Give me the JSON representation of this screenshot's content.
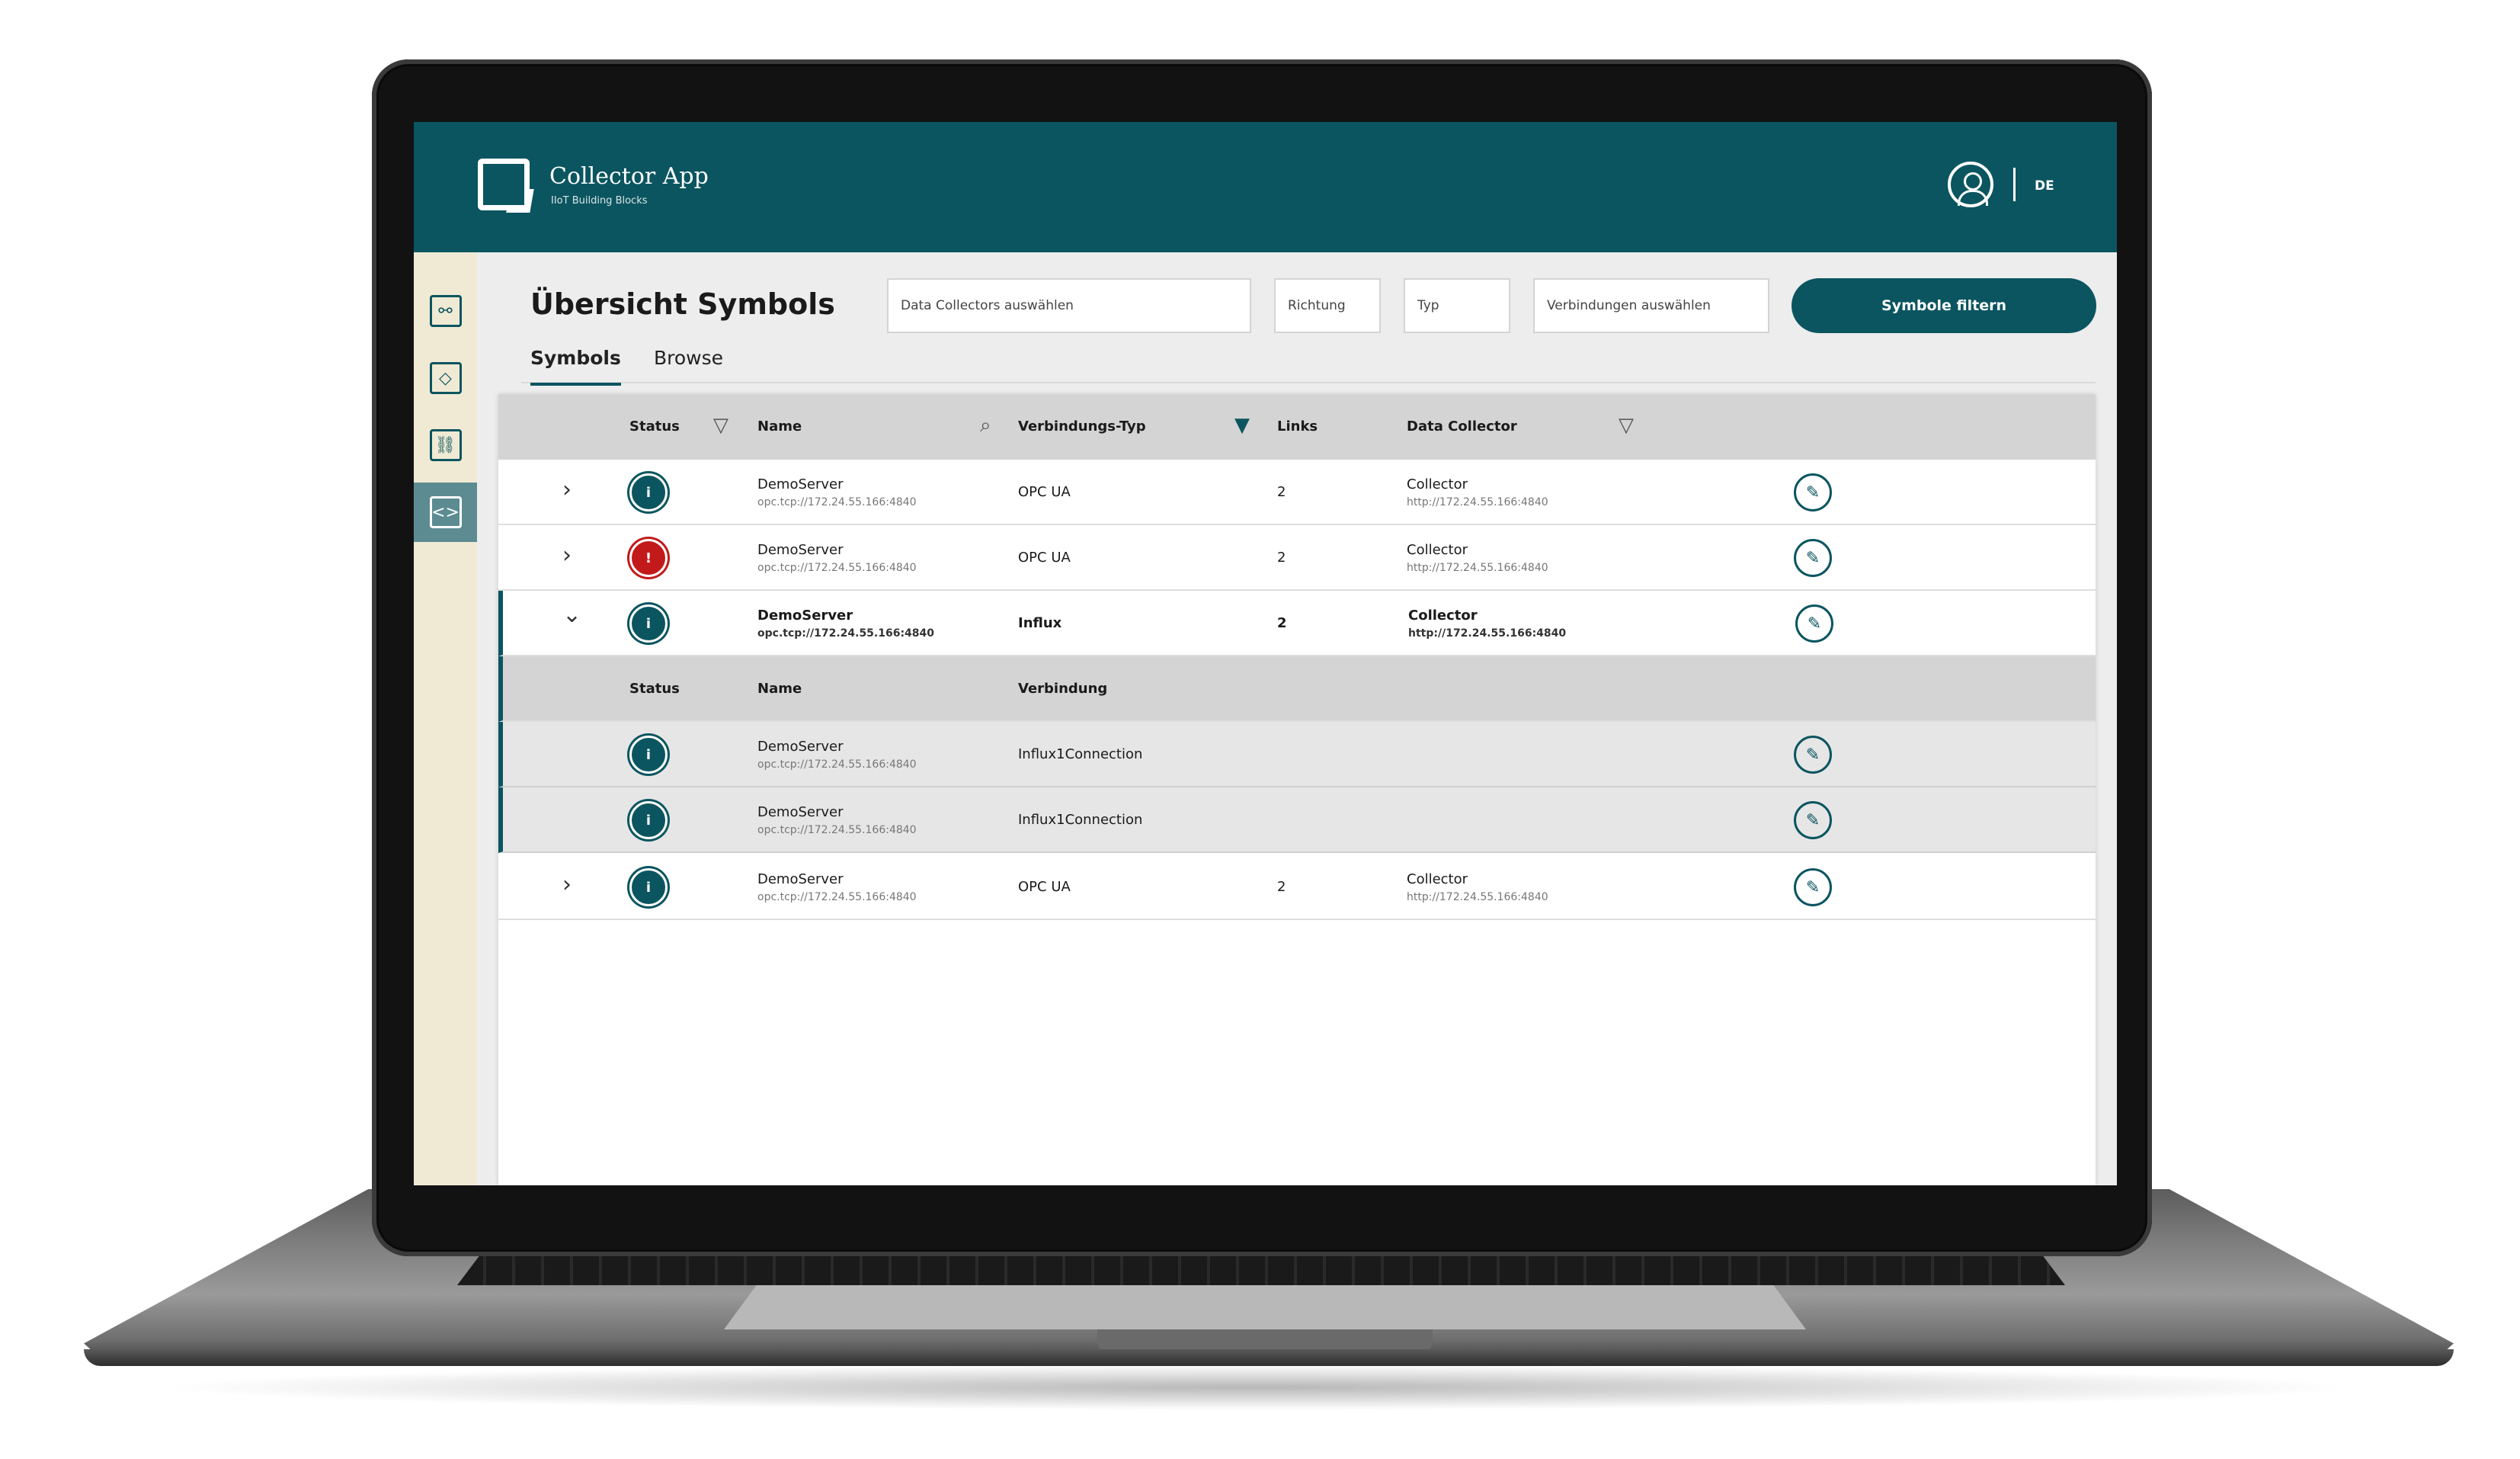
{
  "header": {
    "app_title": "Collector App",
    "app_subtitle": "IIoT Building Blocks",
    "language": "DE"
  },
  "sidebar": {
    "items": [
      {
        "name": "network",
        "glyph": "⚯"
      },
      {
        "name": "collector",
        "glyph": "◇"
      },
      {
        "name": "links",
        "glyph": "⛓"
      },
      {
        "name": "symbols",
        "glyph": "<>"
      }
    ]
  },
  "page": {
    "title": "Übersicht Symbols",
    "filters": {
      "data_collectors": "Data Collectors auswählen",
      "richtung": "Richtung",
      "typ": "Typ",
      "verbindungen": "Verbindungen auswählen",
      "button": "Symbole filtern"
    },
    "tabs": [
      "Symbols",
      "Browse"
    ]
  },
  "table": {
    "columns": {
      "status": "Status",
      "name": "Name",
      "typ": "Verbindungs-Typ",
      "links": "Links",
      "collector": "Data Collector"
    },
    "rows": [
      {
        "status_glyph": "i",
        "name": "DemoServer",
        "url": "opc.tcp://172.24.55.166:4840",
        "typ": "OPC UA",
        "links": "2",
        "collector": "Collector",
        "collector_url": "http://172.24.55.166:4840"
      },
      {
        "status_glyph": "!",
        "name": "DemoServer",
        "url": "opc.tcp://172.24.55.166:4840",
        "typ": "OPC UA",
        "links": "2",
        "collector": "Collector",
        "collector_url": "http://172.24.55.166:4840"
      },
      {
        "status_glyph": "i",
        "name": "DemoServer",
        "url": "opc.tcp://172.24.55.166:4840",
        "typ": "Influx",
        "links": "2",
        "collector": "Collector",
        "collector_url": "http://172.24.55.166:4840"
      },
      {
        "status_glyph": "i",
        "name": "DemoServer",
        "url": "opc.tcp://172.24.55.166:4840",
        "typ": "OPC UA",
        "links": "2",
        "collector": "Collector",
        "collector_url": "http://172.24.55.166:4840"
      }
    ],
    "subtable": {
      "columns": {
        "status": "Status",
        "name": "Name",
        "verbindung": "Verbindung"
      },
      "rows": [
        {
          "status_glyph": "i",
          "name": "DemoServer",
          "url": "opc.tcp://172.24.55.166:4840",
          "verbindung": "Influx1Connection"
        },
        {
          "status_glyph": "i",
          "name": "DemoServer",
          "url": "opc.tcp://172.24.55.166:4840",
          "verbindung": "Influx1Connection"
        }
      ]
    }
  },
  "icons": {
    "filter": "▽",
    "filter_active": "▼",
    "search": "⌕",
    "chevron_right": "›",
    "chevron_down": "⌄",
    "edit": "✎"
  },
  "colors": {
    "primary": "#0a5560",
    "error": "#c21a1a",
    "sidebar": "#f0ead4"
  }
}
